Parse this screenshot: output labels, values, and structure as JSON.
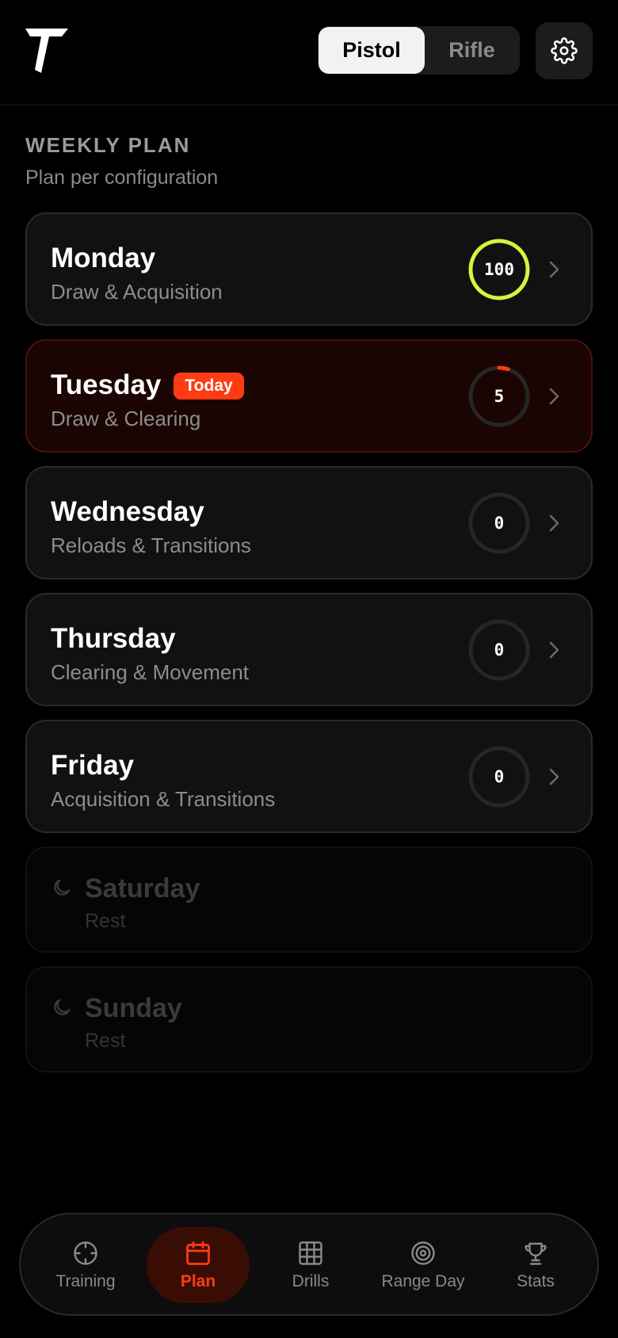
{
  "header": {
    "segments": [
      {
        "label": "Pistol",
        "active": true
      },
      {
        "label": "Rifle",
        "active": false
      }
    ]
  },
  "section": {
    "title": "WEEKLY PLAN",
    "subtitle": "Plan per configuration"
  },
  "days": [
    {
      "day": "Monday",
      "focus": "Draw & Acquisition",
      "value": "100",
      "progress": 1.0,
      "color": "#d4f53c"
    },
    {
      "day": "Tuesday",
      "badge": "Today",
      "focus": "Draw & Clearing",
      "value": "5",
      "progress": 0.05,
      "color": "#ff3b14"
    },
    {
      "day": "Wednesday",
      "focus": "Reloads & Transitions",
      "value": "0",
      "progress": 0
    },
    {
      "day": "Thursday",
      "focus": "Clearing & Movement",
      "value": "0",
      "progress": 0
    },
    {
      "day": "Friday",
      "focus": "Acquisition & Transitions",
      "value": "0",
      "progress": 0
    }
  ],
  "rest_days": [
    {
      "day": "Saturday",
      "focus": "Rest"
    },
    {
      "day": "Sunday",
      "focus": "Rest"
    }
  ],
  "nav": [
    {
      "label": "Training",
      "icon": "crosshair-icon"
    },
    {
      "label": "Plan",
      "icon": "calendar-icon",
      "active": true
    },
    {
      "label": "Drills",
      "icon": "grid-icon"
    },
    {
      "label": "Range Day",
      "icon": "target-icon"
    },
    {
      "label": "Stats",
      "icon": "trophy-icon"
    }
  ],
  "colors": {
    "accent": "#ff3b14",
    "complete": "#d4f53c",
    "background": "#000000",
    "card": "#111111"
  }
}
